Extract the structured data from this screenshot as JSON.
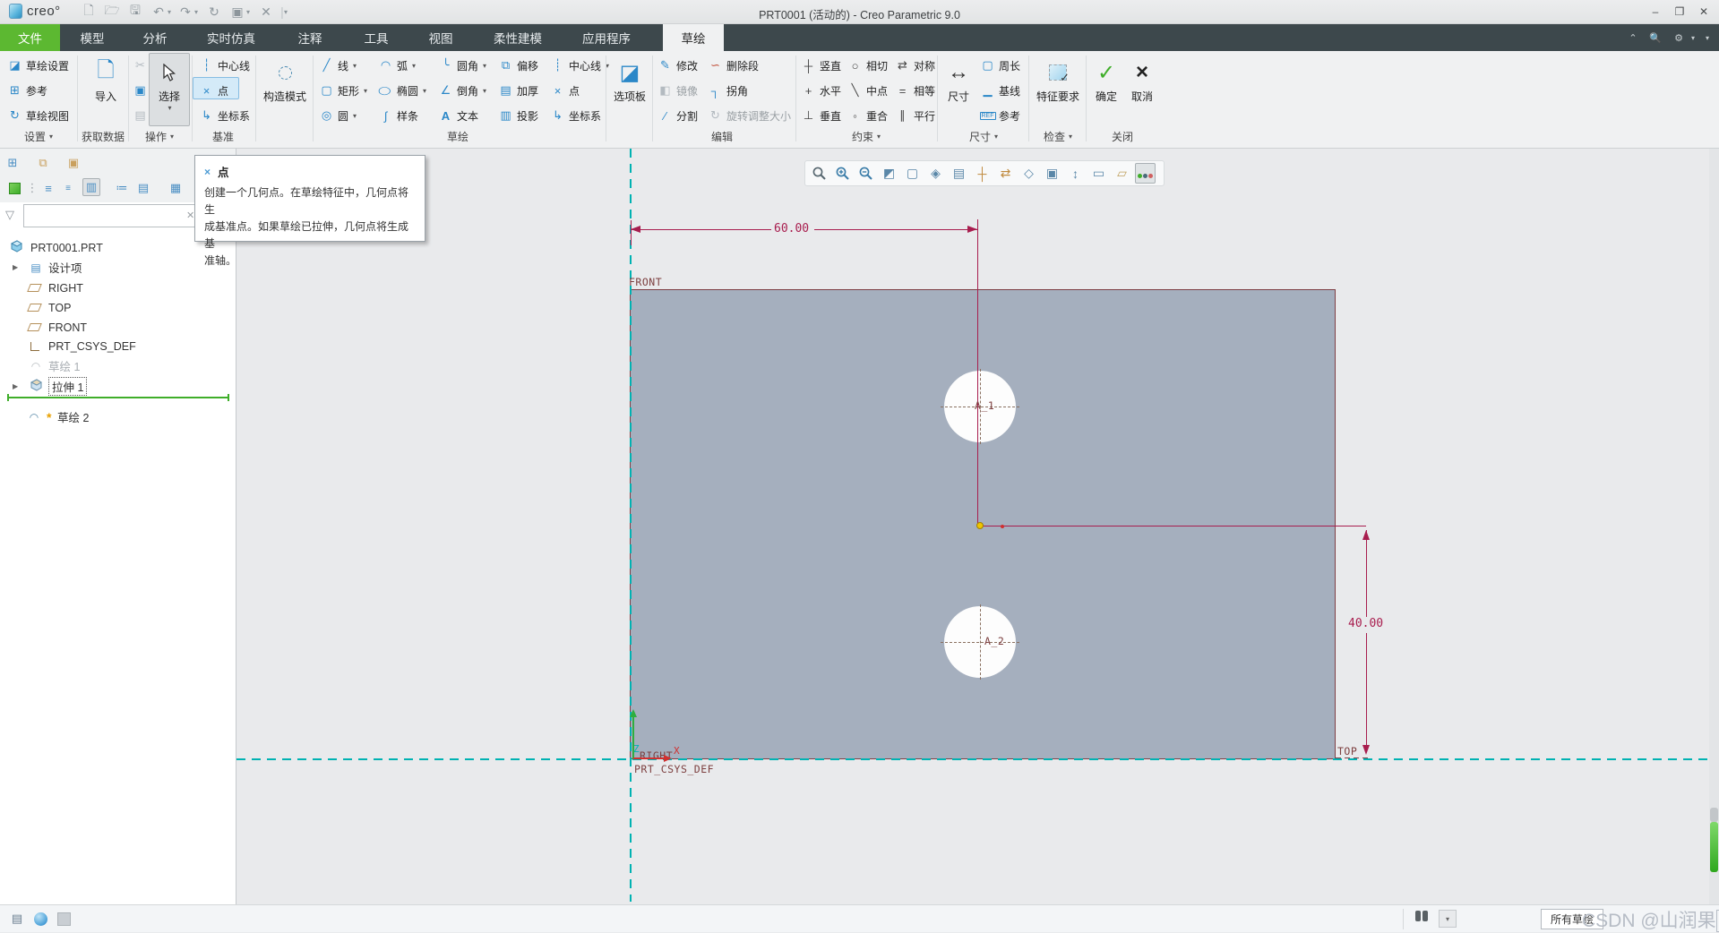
{
  "window": {
    "brand": "creo°",
    "title": "PRT0001 (活动的) - Creo Parametric 9.0",
    "controls": {
      "minimize": "–",
      "maximize": "❐",
      "close": "✕"
    }
  },
  "tabs": {
    "items": [
      "文件",
      "模型",
      "分析",
      "实时仿真",
      "注释",
      "工具",
      "视图",
      "柔性建模",
      "应用程序",
      "草绘"
    ],
    "active": "草绘"
  },
  "r": {
    "settings": {
      "label": "设置",
      "b0": "草绘设置",
      "b1": "参考",
      "b2": "草绘视图"
    },
    "getdata": {
      "label": "获取数据",
      "import": "导入"
    },
    "ops": {
      "label": "操作",
      "select": "选择"
    },
    "datum": {
      "label": "基准",
      "centerline": "中心线",
      "point": "点",
      "csys": "坐标系"
    },
    "sketch": {
      "label": "草绘",
      "construction": "构造模式",
      "palette": "选项板",
      "line": "线",
      "rect": "矩形",
      "circle": "圆",
      "arc": "弧",
      "ellipse": "椭圆",
      "spline": "样条",
      "fillet": "圆角",
      "chamfer": "倒角",
      "text": "文本",
      "offset": "偏移",
      "thicken": "加厚",
      "project": "投影",
      "centerline2": "中心线",
      "point2": "点",
      "csys2": "坐标系"
    },
    "edit": {
      "label": "编辑",
      "modify": "修改",
      "delseg": "删除段",
      "mirror": "镜像",
      "corner": "拐角",
      "divide": "分割",
      "rotate_resize": "旋转调整大小"
    },
    "constrain": {
      "label": "约束",
      "vertical": "竖直",
      "horizontal": "水平",
      "perp": "垂直",
      "tangent": "相切",
      "midpoint": "中点",
      "coincident": "重合",
      "symmetric": "对称",
      "equal": "相等",
      "parallel": "平行"
    },
    "dim": {
      "label": "尺寸",
      "main": "尺寸",
      "perimeter": "周长",
      "baseline": "基线",
      "ref": "参考"
    },
    "inspect": {
      "label": "检查",
      "feature_req": "特征要求"
    },
    "close": {
      "label": "关闭",
      "ok": "确定",
      "cancel": "取消"
    }
  },
  "tooltip": {
    "title": "点",
    "line1": "创建一个几何点。在草绘特征中，几何点将生",
    "line2": "成基准点。如果草绘已拉伸，几何点将生成基",
    "line3": "准轴。"
  },
  "model_tree": {
    "items": [
      {
        "label": "PRT0001.PRT",
        "icon": "part"
      },
      {
        "label": "设计项",
        "icon": "design-items"
      },
      {
        "label": "RIGHT",
        "icon": "datum-plane"
      },
      {
        "label": "TOP",
        "icon": "datum-plane"
      },
      {
        "label": "FRONT",
        "icon": "datum-plane"
      },
      {
        "label": "PRT_CSYS_DEF",
        "icon": "csys"
      },
      {
        "label": "草绘 1",
        "icon": "sketch",
        "state": "suppressed"
      },
      {
        "label": "拉伸 1",
        "icon": "extrude",
        "state": "selected"
      },
      {
        "label": "草绘 2",
        "icon": "sketch",
        "state": "pending-regen"
      }
    ]
  },
  "canvas": {
    "dim_width": "60.00",
    "dim_height": "40.00",
    "front": "FRONT",
    "top": "TOP",
    "right": "RIGHT",
    "csys": "PRT_CSYS_DEF",
    "axis1": "A_1",
    "axis2": "A_2",
    "x_label": "X",
    "z_label": "Z"
  },
  "status_bar": {
    "sketch_filter": "所有草绘",
    "watermark_head": "CSDN @山润果",
    "watermark_tail": "子"
  }
}
